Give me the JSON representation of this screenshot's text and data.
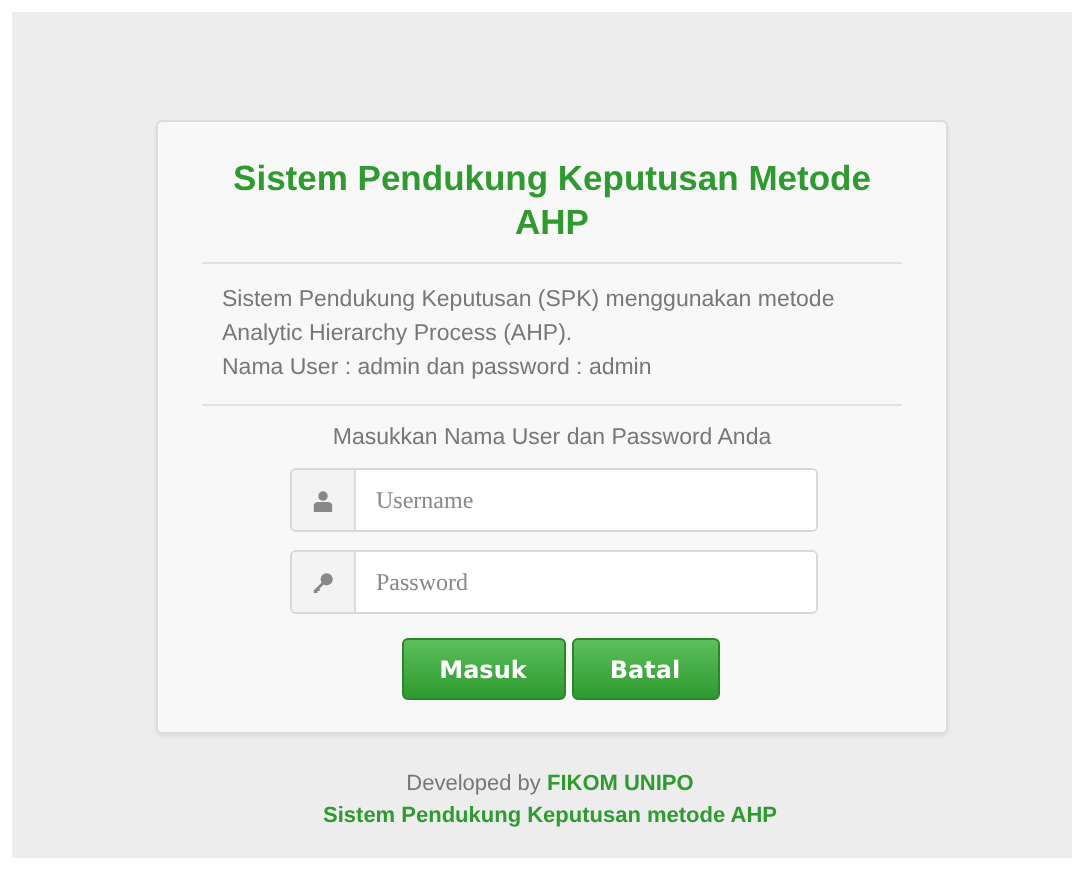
{
  "card": {
    "title": "Sistem Pendukung Keputusan Metode AHP",
    "description": "Sistem Pendukung Keputusan (SPK) menggunakan metode Analytic Hierarchy Process (AHP).",
    "credentials": "Nama User : admin dan password : admin",
    "prompt": "Masukkan Nama User dan Password Anda",
    "fields": [
      {
        "kind": "user",
        "placeholder": "Username"
      },
      {
        "kind": "password",
        "placeholder": "Password"
      }
    ],
    "buttons": [
      "Masuk",
      "Batal"
    ]
  },
  "footer": {
    "credit": "Developed by **FIKOM UNIPO**",
    "subtitle": "Sistem Pendukung Keputusan metode AHP"
  }
}
